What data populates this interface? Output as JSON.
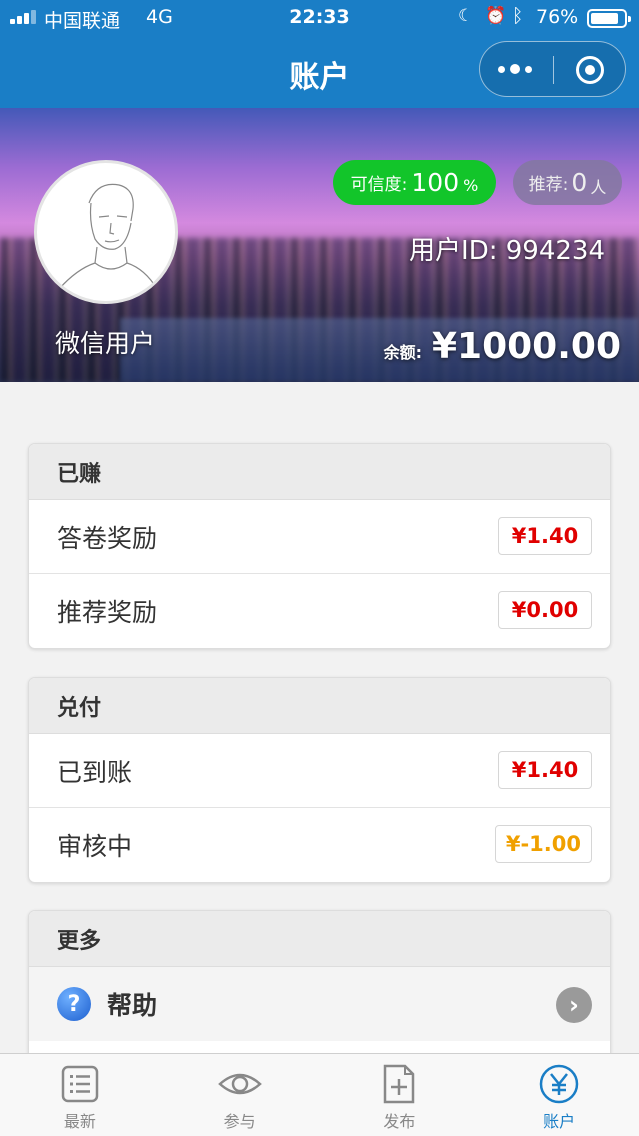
{
  "status_bar": {
    "carrier": "中国联通",
    "network": "4G",
    "time": "22:33",
    "battery": "76%",
    "icons": [
      "signal-icon",
      "moon-icon",
      "alarm-icon",
      "bluetooth-icon",
      "battery-icon"
    ]
  },
  "nav": {
    "title": "账户",
    "icons": [
      "more-icon",
      "close-icon"
    ]
  },
  "profile": {
    "nickname": "微信用户",
    "credit_label": "可信度:",
    "credit_value": "100",
    "credit_unit": "%",
    "referral_label": "推荐:",
    "referral_value": "0",
    "referral_unit": "人",
    "user_id": "用户ID: 994234",
    "balance_label": "余额:",
    "balance_value": "¥1000.00"
  },
  "earned": {
    "title": "已赚",
    "rows": [
      {
        "label": "答卷奖励",
        "amount": "¥1.40"
      },
      {
        "label": "推荐奖励",
        "amount": "¥0.00"
      }
    ]
  },
  "redeem": {
    "title": "兑付",
    "rows": [
      {
        "label": "已到账",
        "amount": "¥1.40"
      },
      {
        "label": "审核中",
        "amount": "¥-1.00"
      }
    ]
  },
  "more": {
    "title": "更多",
    "help_label": "帮助",
    "icons": [
      "help-icon",
      "chevron-right-icon"
    ]
  },
  "colors": {
    "primary": "#1a7ec6",
    "credit_green": "#12c52a",
    "amount_red": "#e00000",
    "amount_pending": "#f0a000"
  },
  "tabs": [
    {
      "label": "最新",
      "icon": "list-icon",
      "active": false
    },
    {
      "label": "参与",
      "icon": "eye-icon",
      "active": false
    },
    {
      "label": "发布",
      "icon": "add-document-icon",
      "active": false
    },
    {
      "label": "账户",
      "icon": "yuan-icon",
      "active": true
    }
  ]
}
